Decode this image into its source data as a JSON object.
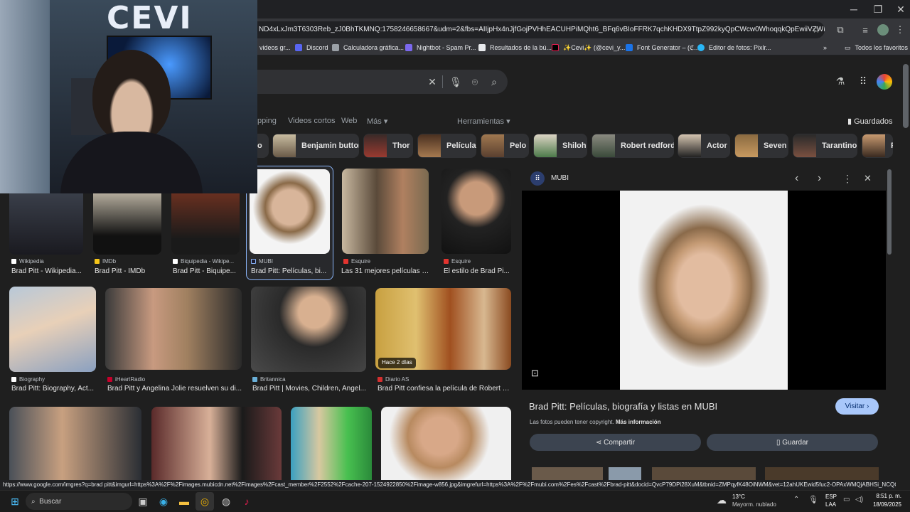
{
  "browser": {
    "url": "ND4xLxJm3T6303Reb_zJ0BhTKMNQ:1758246658667&udm=2&fbs=AIIjpHx4nJjfGojPVHhEACUHPiMQht6_BFq6vBIoFFRK7qchKHDX9TtpZ992kyQpCWcw0WhoqqkQpEwiiVZWE9GZTg9ws...",
    "bookmarks": [
      "videos gr...",
      "Discord",
      "Calculadora gráfica...",
      "Nightbot - Spam Pr...",
      "Resultados de la bú...",
      "✨Cevi✨ (@cevi_y...",
      "Font Generator – (ℭ...",
      "Editor de fotos: Pixlr..."
    ],
    "bookmark_overflow": "»",
    "all_favorites": "Todos los favoritos"
  },
  "search": {
    "tabs": [
      "pping",
      "Videos cortos",
      "Web",
      "Más ▾"
    ],
    "tools": "Herramientas ▾",
    "saved": "Guardados",
    "chips": [
      "o",
      "Benjamin button",
      "Thor",
      "Película",
      "Pelo",
      "Shiloh",
      "Robert redford",
      "Actor",
      "Seven",
      "Tarantino",
      "F"
    ]
  },
  "results": [
    {
      "source": "Wikipedia",
      "title": "Brad Pitt - Wikipedia..."
    },
    {
      "source": "IMDb",
      "title": "Brad Pitt - IMDb"
    },
    {
      "source": "Biquipedia - Wikipe...",
      "title": "Brad Pitt - Biquipe..."
    },
    {
      "source": "MUBI",
      "title": "Brad Pitt: Películas, bi..."
    },
    {
      "source": "Esquire",
      "title": "Las 31 mejores películas d..."
    },
    {
      "source": "Esquire",
      "title": "El estilo de Brad Pi..."
    },
    {
      "source": "Biography",
      "title": "Brad Pitt: Biography, Act..."
    },
    {
      "source": "iHeartRadio",
      "title": "Brad Pitt y Angelina Jolie resuelven su di..."
    },
    {
      "source": "Britannica",
      "title": "Brad Pitt | Movies, Children, Angel..."
    },
    {
      "source": "Diario AS",
      "title": "Brad Pitt confiesa la película de Robert R..."
    }
  ],
  "badge_recent": "Hace 2 días",
  "panel": {
    "site": "MUBI",
    "title": "Brad Pitt: Películas, biografía y listas en MUBI",
    "visit": "Visitar",
    "copyright": "Las fotos pueden tener copyright.",
    "more_info": "Más información",
    "share": "Compartir",
    "save": "Guardar"
  },
  "status_url": "https://www.google.com/imgres?q=brad pitt&imgurl=https%3A%2F%2Fimages.mubicdn.net%2Fimages%2Fcast_member%2F2552%2Fcache-207-1524922850%2Fimage-w856.jpg&imgrefurl=https%3A%2F%2Fmubi.com%2Fes%2Fcast%2Fbrad-pitt&docid=QvcP79DPi28XuM&tbnid=ZMPqyfK48OiNWM&vet=12ahUKEwid5fuc2-OPAxWMQjABHSi_NCQQ...",
  "taskbar": {
    "search": "Buscar",
    "temp": "13°C",
    "weather": "Mayorm. nublado",
    "lang1": "ESP",
    "lang2": "LAA",
    "time": "8:51 p. m.",
    "date": "18/09/2025"
  },
  "webcam_sign": "CEVI",
  "colors": {
    "accent": "#8ab4f8",
    "page": "#1f1f1f",
    "chip": "#303134",
    "visit_btn": "#a8c7fa"
  }
}
